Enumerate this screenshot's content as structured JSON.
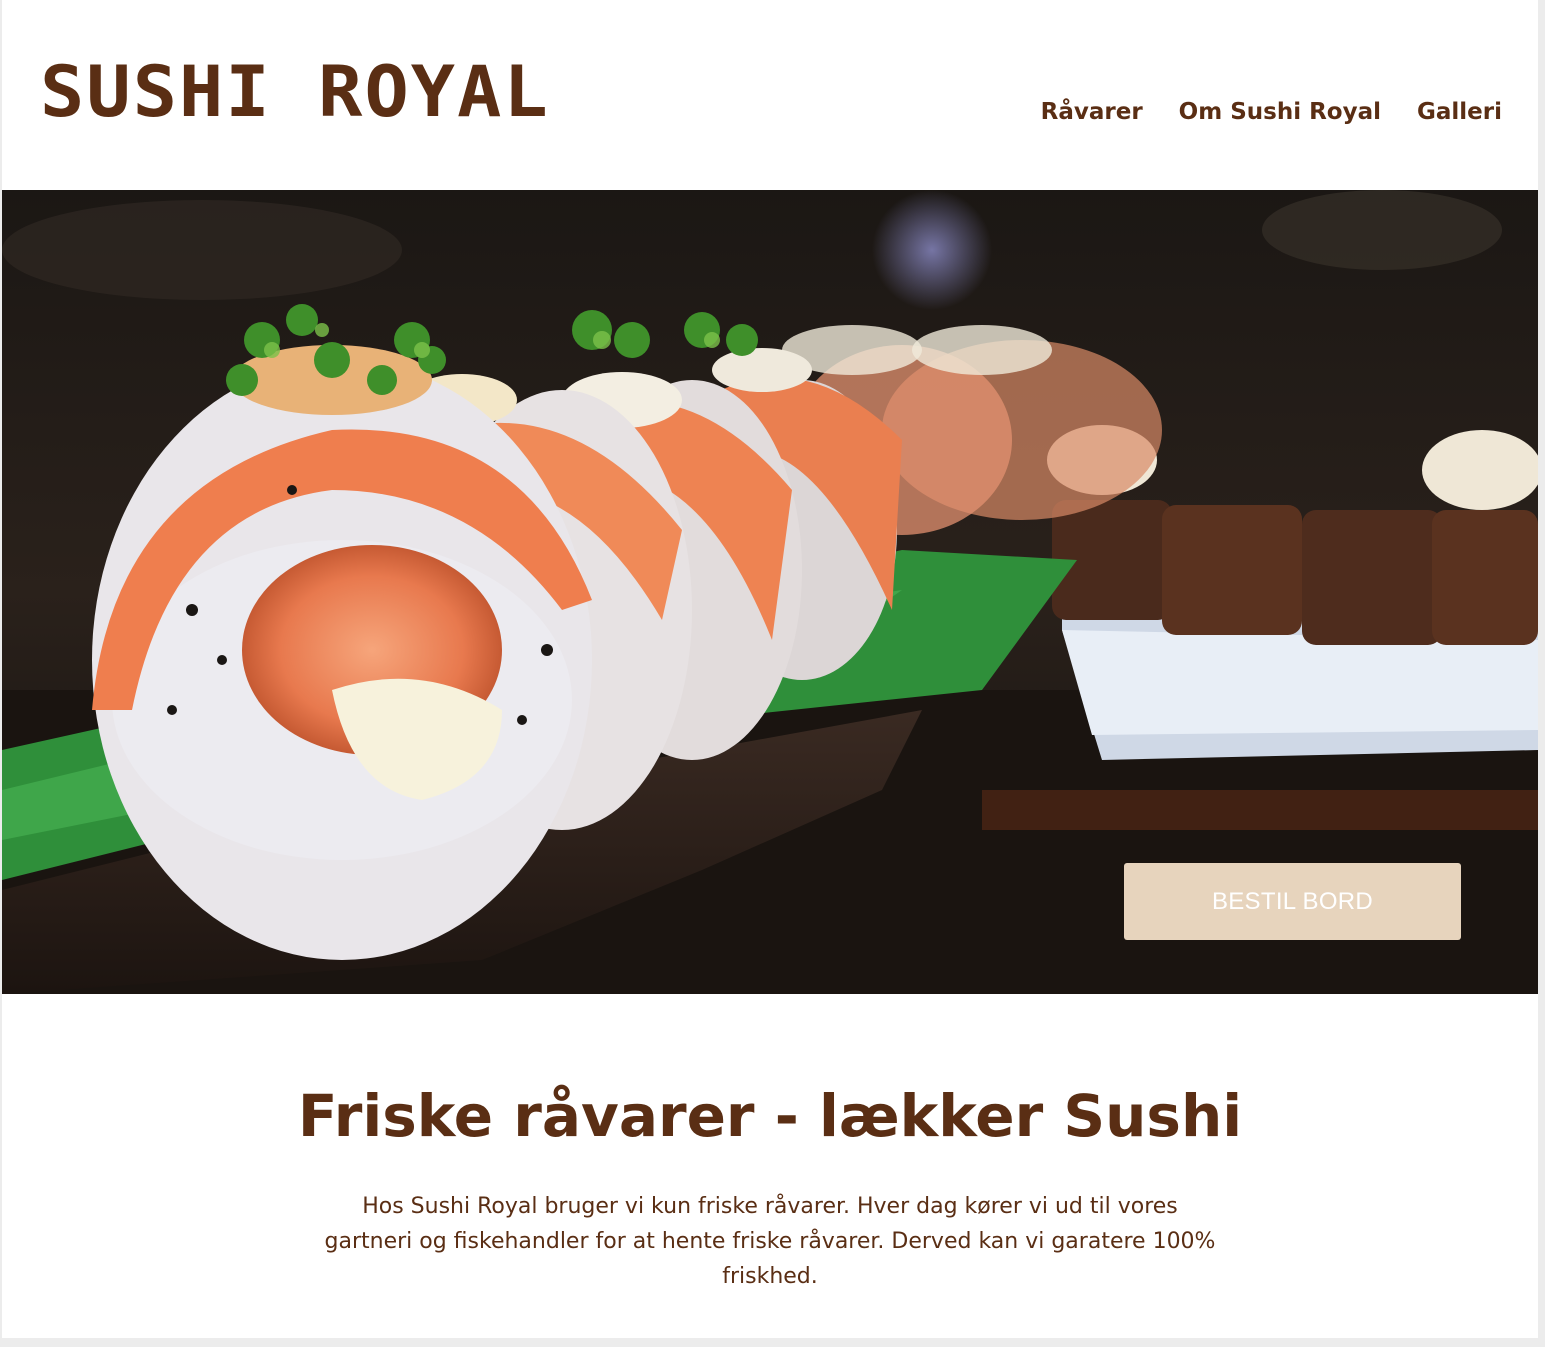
{
  "brand": {
    "logo": "SUSHI ROYAL"
  },
  "nav": {
    "items": [
      "Råvarer",
      "Om Sushi Royal",
      "Galleri"
    ]
  },
  "hero": {
    "cta_label": "BESTIL BORD"
  },
  "content": {
    "headline": "Friske råvarer - lækker Sushi",
    "body": "Hos Sushi Royal bruger vi kun friske råvarer. Hver dag kører vi ud til vores gartneri og fiskehandler for at hente friske råvarer. Derved kan vi garatere 100% friskhed."
  },
  "colors": {
    "brand_brown": "#5a2e14",
    "cta_beige": "#e7d4bd"
  }
}
